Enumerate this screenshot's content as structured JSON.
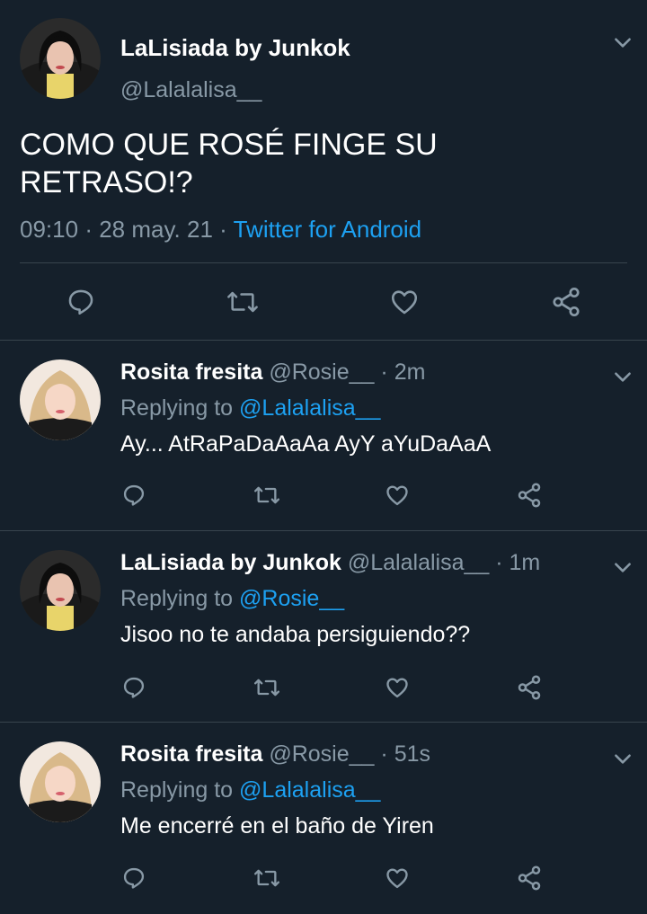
{
  "main_tweet": {
    "display_name": "LaLisiada by Junkok",
    "handle": "@Lalalalisa__",
    "text_line1": "COMO QUE ROSÉ FINGE SU",
    "text_line2": "RETRASO!?",
    "time": "09:10",
    "date": "28 may. 21",
    "separator": "·",
    "source": "Twitter for Android"
  },
  "replies": [
    {
      "display_name": "Rosita fresita",
      "handle": "@Rosie__",
      "separator": "·",
      "age": "2m",
      "replying_label": "Replying to",
      "replying_handle": "@Lalalalisa__",
      "text": "Ay... AtRaPaDaAaAa AyY aYuDaAaA",
      "avatar": "rose-avatar"
    },
    {
      "display_name": "LaLisiada by Junkok",
      "handle": "@Lalalalisa__",
      "separator": "·",
      "age": "1m",
      "replying_label": "Replying to",
      "replying_handle": "@Rosie__",
      "text": "Jisoo no te andaba persiguiendo??",
      "avatar": "lisa-avatar"
    },
    {
      "display_name": "Rosita fresita",
      "handle": "@Rosie__",
      "separator": "·",
      "age": "51s",
      "replying_label": "Replying to",
      "replying_handle": "@Lalalalisa__",
      "text": "Me encerré en el baño de Yiren",
      "avatar": "rose-avatar"
    }
  ],
  "icons": [
    "chevron-down-icon",
    "reply-icon",
    "retweet-icon",
    "like-icon",
    "share-icon"
  ],
  "colors": {
    "background": "#15202b",
    "divider": "#38444d",
    "muted": "#8899a6",
    "link": "#1da1f2",
    "text": "#ffffff"
  }
}
